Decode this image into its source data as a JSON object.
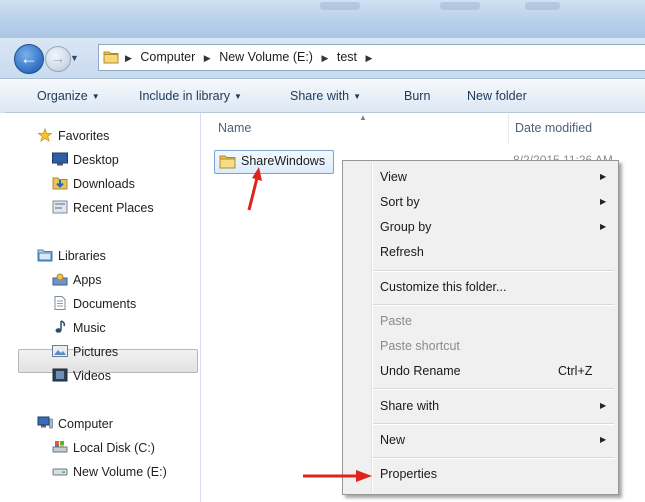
{
  "address": {
    "crumbs": [
      "Computer",
      "New Volume (E:)",
      "test"
    ]
  },
  "toolbar": {
    "organize": "Organize",
    "include_in_library": "Include in library",
    "share_with": "Share with",
    "burn": "Burn",
    "new_folder": "New folder"
  },
  "navpane": {
    "favorites": "Favorites",
    "desktop": "Desktop",
    "downloads": "Downloads",
    "recent_places": "Recent Places",
    "libraries": "Libraries",
    "apps": "Apps",
    "documents": "Documents",
    "music": "Music",
    "pictures": "Pictures",
    "videos": "Videos",
    "computer": "Computer",
    "local_disk": "Local Disk (C:)",
    "new_volume": "New Volume (E:)"
  },
  "list": {
    "col_name": "Name",
    "col_date": "Date modified",
    "file_name": "ShareWindows",
    "file_date": "8/2/2015 11:26 AM"
  },
  "context_menu": {
    "view": "View",
    "sort_by": "Sort by",
    "group_by": "Group by",
    "refresh": "Refresh",
    "customize": "Customize this folder...",
    "paste": "Paste",
    "paste_shortcut": "Paste shortcut",
    "undo_rename": "Undo Rename",
    "undo_rename_shortcut": "Ctrl+Z",
    "share_with": "Share with",
    "new": "New",
    "properties": "Properties"
  },
  "colors": {
    "annotation_arrow": "#e0231c",
    "selection_border": "#7da2ce"
  }
}
